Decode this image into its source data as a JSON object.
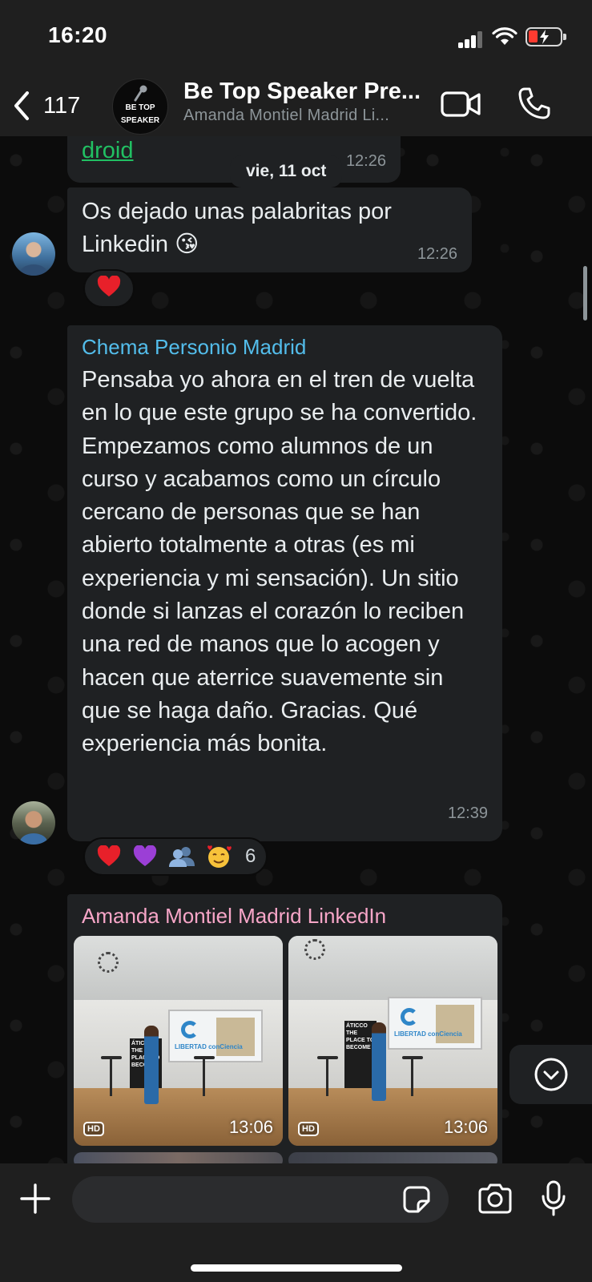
{
  "status_bar": {
    "time": "16:20"
  },
  "header": {
    "back_count": "117",
    "title": "Be Top Speaker Pre...",
    "subtitle": "Amanda Montiel Madrid Li...",
    "avatar_logo_line1": "BE TOP",
    "avatar_logo_line2": "SPEAKER"
  },
  "chat": {
    "date_separator": "vie, 11 oct",
    "previous_message": {
      "link_text": "droid",
      "time": "12:26"
    },
    "messages": [
      {
        "text": "Os dejado unas palabritas por Linkedin 😘",
        "time": "12:26",
        "reactions": [
          "❤️"
        ]
      },
      {
        "sender": "Chema Personio Madrid",
        "sender_color": "#53bdeb",
        "text": "Pensaba yo ahora en el tren de vuelta en lo que este grupo se ha convertido. Empezamos como alumnos de un curso y acabamos como un círculo cercano de personas que se han abierto totalmente a otras (es mi experiencia y mi sensación). Un sitio donde si lanzas el corazón lo reciben una red de manos que lo acogen y hacen que aterrice suavemente sin que se haga daño. Gracias. Qué experiencia más bonita.",
        "time": "12:39",
        "reactions": [
          "❤️",
          "💜",
          "👥",
          "🥰"
        ],
        "reaction_count": "6"
      },
      {
        "sender": "Amanda Montiel Madrid LinkedIn",
        "sender_color": "#f7a6c8",
        "photos": [
          {
            "badge": "HD",
            "time": "13:06",
            "banner_text": "ÁTICCO THE PLACE TO BECOME",
            "screen_label": "LIBERTAD conCiencia"
          },
          {
            "badge": "HD",
            "time": "13:06",
            "banner_text": "ÁTICCO THE PLACE TO BECOME",
            "screen_label": "LIBERTAD conCiencia"
          }
        ]
      }
    ]
  },
  "input_bar": {
    "placeholder": ""
  },
  "colors": {
    "accent_green": "#21c063",
    "bubble_bg": "#1f2123",
    "header_bg": "#1f1f1f"
  }
}
